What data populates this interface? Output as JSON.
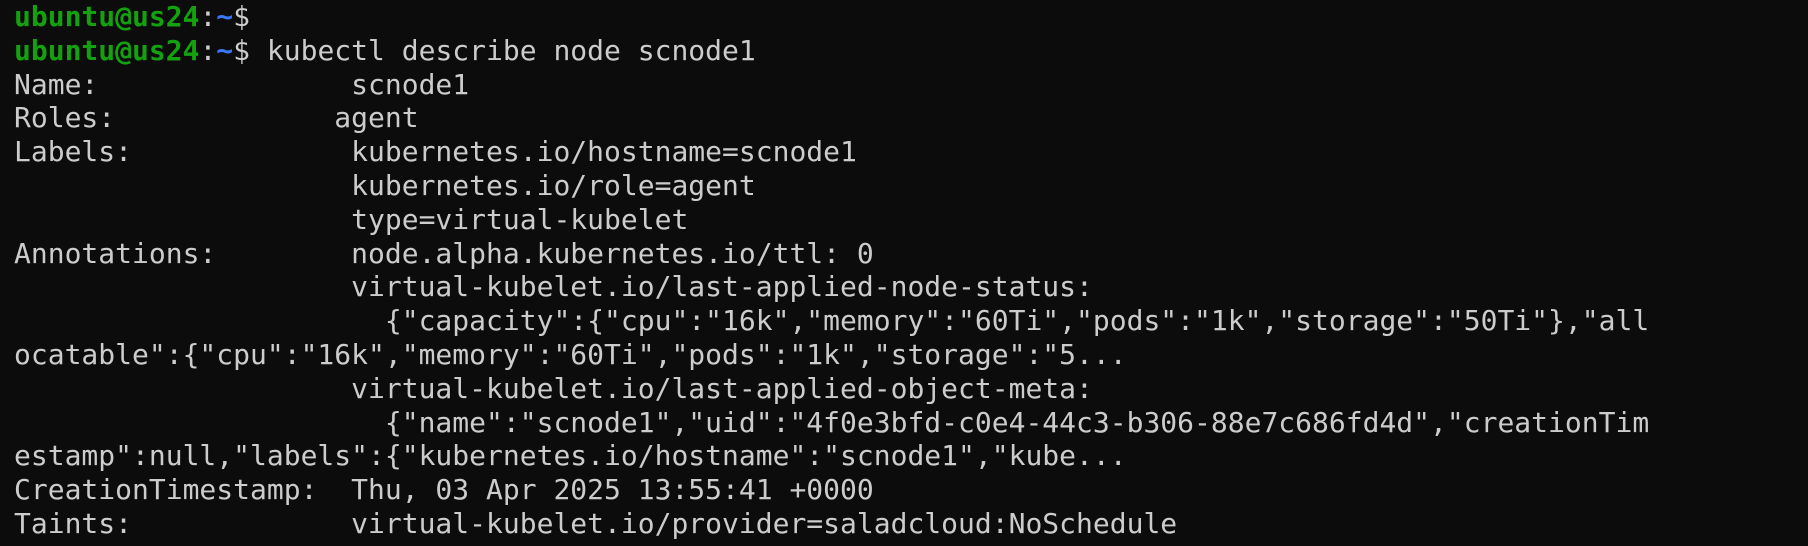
{
  "terminal": {
    "prompt_user_host": "ubuntu@us24",
    "prompt_colon": ":",
    "prompt_path": "~",
    "prompt_symbol": "$",
    "command": " kubectl describe node scnode1",
    "lines": [
      "Name:               scnode1",
      "Roles:             agent",
      "Labels:             kubernetes.io/hostname=scnode1",
      "                    kubernetes.io/role=agent",
      "                    type=virtual-kubelet",
      "Annotations:        node.alpha.kubernetes.io/ttl: 0",
      "                    virtual-kubelet.io/last-applied-node-status:",
      "                      {\"capacity\":{\"cpu\":\"16k\",\"memory\":\"60Ti\",\"pods\":\"1k\",\"storage\":\"50Ti\"},\"all",
      "ocatable\":{\"cpu\":\"16k\",\"memory\":\"60Ti\",\"pods\":\"1k\",\"storage\":\"5...",
      "                    virtual-kubelet.io/last-applied-object-meta:",
      "                      {\"name\":\"scnode1\",\"uid\":\"4f0e3bfd-c0e4-44c3-b306-88e7c686fd4d\",\"creationTim",
      "estamp\":null,\"labels\":{\"kubernetes.io/hostname\":\"scnode1\",\"kube...",
      "CreationTimestamp:  Thu, 03 Apr 2025 13:55:41 +0000",
      "Taints:             virtual-kubelet.io/provider=saladcloud:NoSchedule"
    ]
  }
}
